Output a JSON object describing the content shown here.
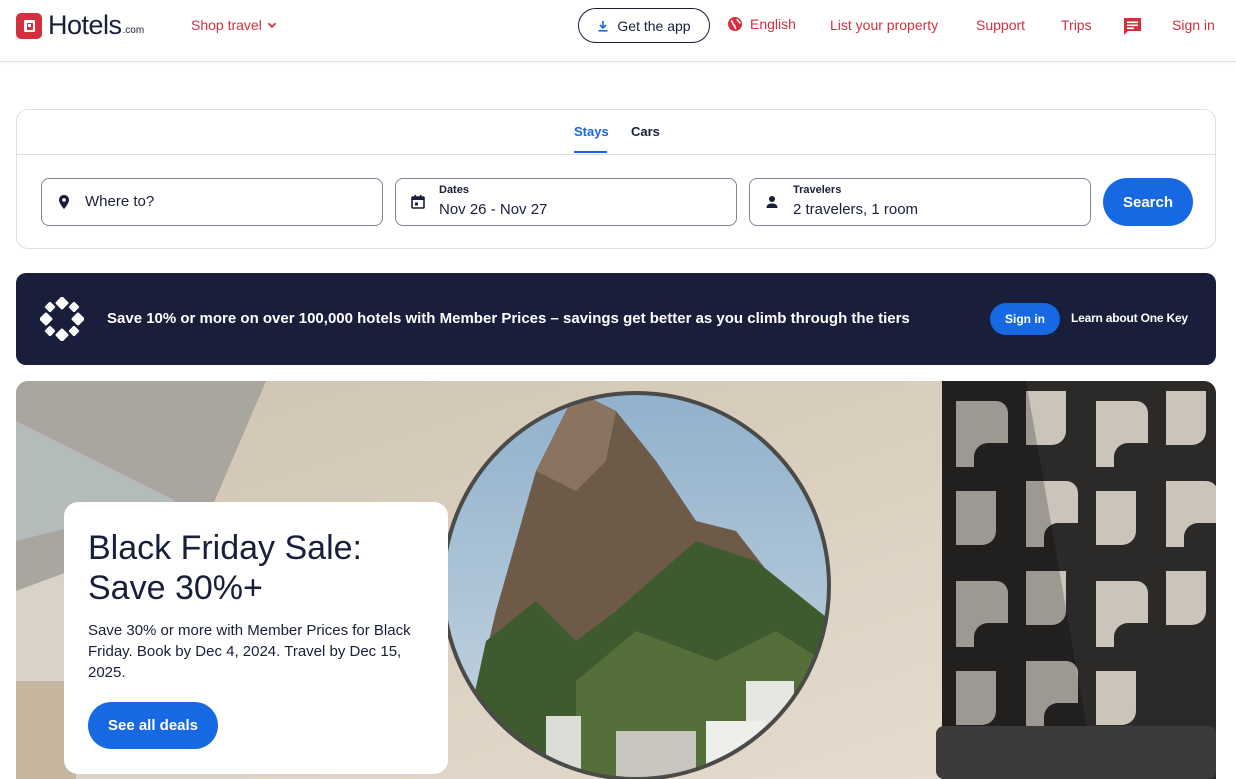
{
  "brand": {
    "name": "Hotels",
    "suffix": ".com",
    "accent": "#d32f3f",
    "primary": "#1668e3",
    "dark": "#191e3b"
  },
  "header": {
    "shop_travel": "Shop travel",
    "get_app": "Get the app",
    "language": "English",
    "list_property": "List your property",
    "support": "Support",
    "trips": "Trips",
    "sign_in": "Sign in"
  },
  "search": {
    "tabs": [
      {
        "label": "Stays",
        "active": true
      },
      {
        "label": "Cars",
        "active": false
      }
    ],
    "where": {
      "placeholder": "Where to?"
    },
    "dates": {
      "label": "Dates",
      "value": "Nov 26 - Nov 27"
    },
    "travelers": {
      "label": "Travelers",
      "value": "2 travelers, 1 room"
    },
    "button": "Search"
  },
  "member_banner": {
    "text": "Save 10% or more on over 100,000 hotels with Member Prices – savings get better as you climb through the tiers",
    "sign_in": "Sign in",
    "learn": "Learn about One Key"
  },
  "promo": {
    "title": "Black Friday Sale: Save 30%+",
    "body": "Save 30% or more with Member Prices for Black Friday. Book by Dec 4, 2024. Travel by Dec 15, 2025.",
    "button": "See all deals"
  }
}
